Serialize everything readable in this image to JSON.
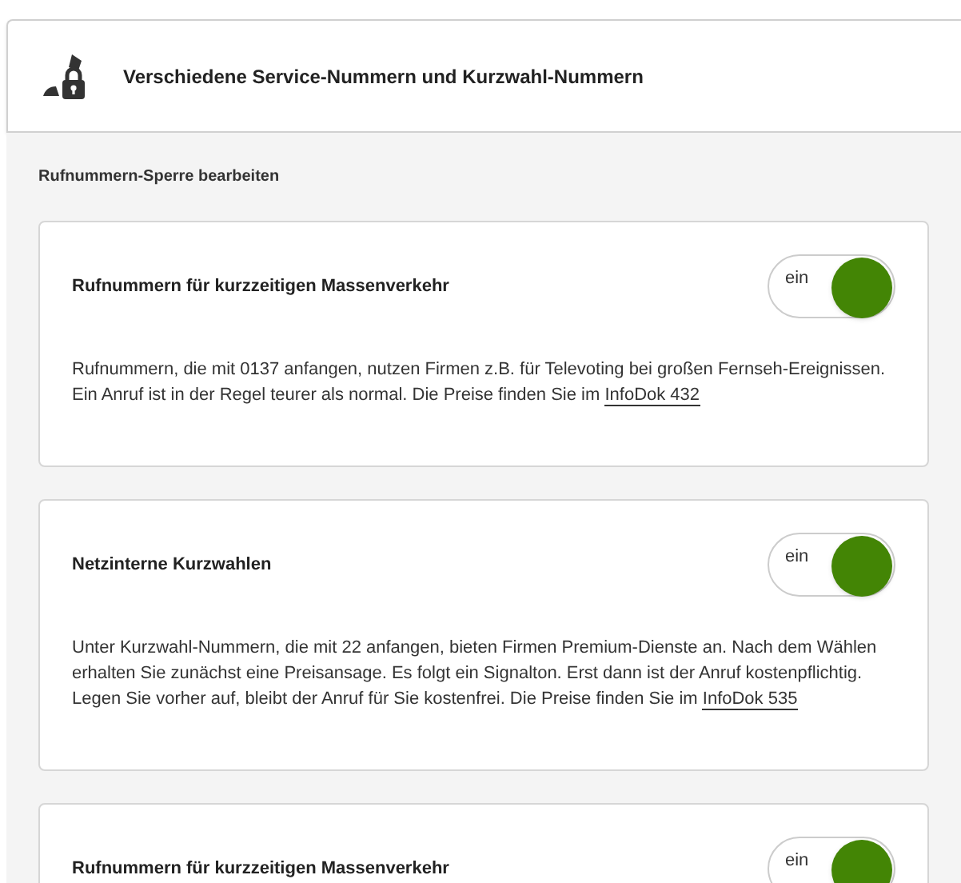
{
  "header": {
    "title": "Verschiedene Service-Nummern und Kurzwahl-Nummern"
  },
  "section_title": "Rufnummern-Sperre bearbeiten",
  "cards": [
    {
      "title": "Rufnummern für kurzzeitigen Massenverkehr",
      "toggle_label": "ein",
      "on": true,
      "description": "Rufnummern, die mit 0137 anfangen, nutzen Firmen z.B. für Televoting bei großen Fernseh-Ereignissen. Ein Anruf ist in der Regel teurer als normal. Die Preise finden Sie im",
      "link": "InfoDok 432"
    },
    {
      "title": "Netzinterne Kurzwahlen",
      "toggle_label": "ein",
      "on": true,
      "description": "Unter Kurzwahl-Nummern, die mit 22 anfangen, bieten Firmen Premium-Dienste an. Nach dem Wählen erhalten Sie zunächst eine Preisansage. Es folgt ein Signalton. Erst dann ist der Anruf kostenpflichtig. Legen Sie vorher auf, bleibt der Anruf für Sie kostenfrei. Die Preise finden Sie im",
      "link": "InfoDok 535"
    },
    {
      "title": "Rufnummern für kurzzeitigen Massenverkehr",
      "toggle_label": "ein",
      "on": true
    }
  ]
}
